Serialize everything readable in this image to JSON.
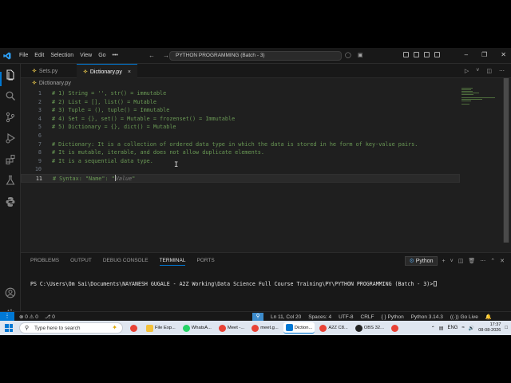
{
  "titlebar": {
    "menu": [
      "File",
      "Edit",
      "Selection",
      "View",
      "Go",
      "•••"
    ],
    "command_center": "PYTHON PROGRAMMING (Batch - 3)"
  },
  "tabs": [
    {
      "label": "Sets.py",
      "active": false
    },
    {
      "label": "Dictionary.py",
      "active": true,
      "close": "×"
    }
  ],
  "breadcrumb": "Dictionary.py",
  "editor": {
    "lines": [
      {
        "n": "1",
        "text": "# 1) String = '', str() = immutable"
      },
      {
        "n": "2",
        "text": "# 2) List = [], list() = Mutable"
      },
      {
        "n": "3",
        "text": "# 3) Tuple = (), tuple() = Immutable"
      },
      {
        "n": "4",
        "text": "# 4) Set = {}, set() = Mutable = frozenset() = Immutable"
      },
      {
        "n": "5",
        "text": "# 5) Dictionary = {}, dict() = Mutable"
      },
      {
        "n": "6",
        "text": ""
      },
      {
        "n": "7",
        "text": "# Dictionary: It is a collection of ordered data type in which the data is stored in he form of key-value pairs."
      },
      {
        "n": "8",
        "text": "# It is mutable, iterable, and does not allow duplicate elements."
      },
      {
        "n": "9",
        "text": "# It is a sequential data type."
      },
      {
        "n": "10",
        "text": ""
      },
      {
        "n": "11",
        "text": "# Syntax: \"Name\": \"",
        "placeholder": "Value",
        "after": "\"",
        "current": true
      }
    ]
  },
  "panel": {
    "tabs": [
      "PROBLEMS",
      "OUTPUT",
      "DEBUG CONSOLE",
      "TERMINAL",
      "PORTS"
    ],
    "active_tab": "TERMINAL",
    "terminal_name": "Python",
    "prompt": "PS C:\\Users\\Om Sai\\Documents\\NAYANESH GUGALE - A2Z Working\\Data Science Full Course Training\\PY\\PYTHON PROGRAMMING (Batch - 3)>"
  },
  "statusbar": {
    "problems": "⊗ 0  ⚠ 0",
    "ports": "⎇ 0",
    "position": "Ln 11, Col 20",
    "spaces": "Spaces: 4",
    "encoding": "UTF-8",
    "eol": "CRLF",
    "language": "{ } Python",
    "interpreter": "Python 3.14.3",
    "golive": "((·)) Go Live"
  },
  "taskbar": {
    "search_placeholder": "Type here to search",
    "apps": [
      {
        "label": "",
        "color": "#e94235"
      },
      {
        "label": "File Exp...",
        "color": "#f3c13a"
      },
      {
        "label": "WhatsA...",
        "color": "#25d366"
      },
      {
        "label": "Meet -...",
        "color": "#e94235"
      },
      {
        "label": "meet.g...",
        "color": "#e94235"
      },
      {
        "label": "Diction...",
        "color": "#0078d4",
        "active": true
      },
      {
        "label": "A2Z C8...",
        "color": "#e94235"
      },
      {
        "label": "OBS 32...",
        "color": "#222222"
      },
      {
        "label": "",
        "color": "#e94235"
      }
    ],
    "lang": "ENG",
    "time": "17:37",
    "date": "08-08-2026"
  },
  "colors": {
    "accent": "#0078d4",
    "comment": "#6a9955",
    "editor_bg": "#1f1f1f"
  }
}
